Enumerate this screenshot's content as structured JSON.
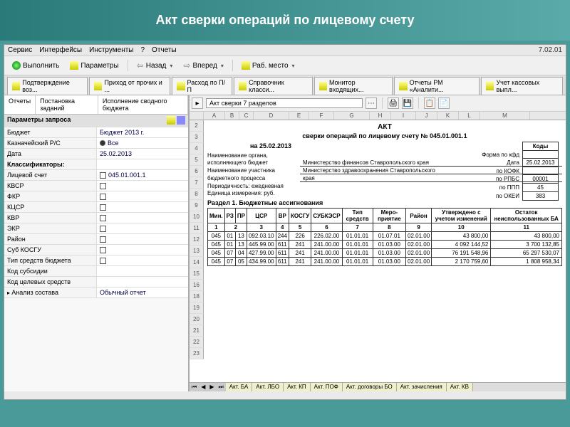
{
  "header": {
    "title": "Акт сверки операций по лицевому счету"
  },
  "menubar": {
    "items": [
      "Сервис",
      "Интерфейсы",
      "Инструменты",
      "?",
      "Отчеты"
    ],
    "version": "7.02.01"
  },
  "toolbar1": {
    "execute": "Выполнить",
    "params": "Параметры",
    "back": "Назад",
    "forward": "Вперед",
    "workplace": "Раб. место"
  },
  "toolbar2": {
    "tabs": [
      "Подтверждение воз...",
      "Приход от прочих и ...",
      "Расход по П/П",
      "Справочник класси...",
      "Монитор входящих...",
      "Отчеты РМ «Аналити...",
      "Учет кассовых выпл..."
    ]
  },
  "left": {
    "tabs": [
      "Отчеты",
      "Постановка заданий",
      "Исполнение сводного бюджета"
    ],
    "header": "Параметры запроса",
    "rows": [
      {
        "label": "Бюджет",
        "value": "Бюджет 2013 г."
      },
      {
        "label": "Казначейский Р/С",
        "value": "Все",
        "radio": true
      },
      {
        "label": "Дата",
        "value": "25.02.2013"
      },
      {
        "label": "Классификаторы:",
        "section": true
      },
      {
        "label": "Лицевой счет",
        "value": "045.01.001.1",
        "check": true
      },
      {
        "label": "КВСР",
        "check": true
      },
      {
        "label": "ФКР",
        "check": true
      },
      {
        "label": "КЦСР",
        "check": true
      },
      {
        "label": "КВР",
        "check": true
      },
      {
        "label": "ЭКР",
        "check": true
      },
      {
        "label": "Район",
        "check": true
      },
      {
        "label": "Суб КОСГУ",
        "check": true
      },
      {
        "label": "Тип средств бюджета",
        "check": true
      },
      {
        "label": "Код субсидии"
      },
      {
        "label": "Код целевых средств"
      },
      {
        "label": "Анализ состава",
        "value": "Обычный отчет",
        "expand": true
      }
    ]
  },
  "right": {
    "combo": "Акт сверки 7 разделов",
    "cols": [
      "A",
      "B",
      "C",
      "D",
      "E",
      "F",
      "G",
      "H",
      "I",
      "J",
      "K",
      "L",
      "M"
    ],
    "rownums": [
      2,
      3,
      4,
      5,
      6,
      7,
      8,
      9,
      10,
      11,
      12,
      13,
      14,
      15,
      16,
      18,
      19,
      20,
      21,
      22,
      23
    ],
    "doc": {
      "title": "АКТ",
      "subtitle": "сверки операций по лицевому счету № 045.01.001.1",
      "date": "на 25.02.2013",
      "codes_header": "Коды",
      "codes": [
        {
          "lbl": "Форма по кфд",
          "val": ""
        },
        {
          "lbl": "Дата",
          "val": "25.02.2013"
        },
        {
          "lbl": "по КОФК",
          "val": ""
        },
        {
          "lbl": "по РПБС",
          "val": "00001"
        },
        {
          "lbl": "по ППП",
          "val": "45"
        },
        {
          "lbl": "по ОКЕИ",
          "val": "383"
        }
      ],
      "info": [
        {
          "l": "Наименование органа,",
          "v": ""
        },
        {
          "l": "исполняющего бюджет",
          "v": "Министерство финансов Ставропольского края"
        },
        {
          "l": "Наименование участника",
          "v": "Министерство здравоохранения Ставропольского"
        },
        {
          "l": "бюджетного процесса",
          "v": "края"
        },
        {
          "l": "Периодичность: ежедневная",
          "v": ""
        },
        {
          "l": "Единица измерения: руб.",
          "v": ""
        }
      ],
      "section1": "Раздел 1. Бюджетные ассигнования"
    },
    "table": {
      "headers": [
        "Мин.",
        "РЗ",
        "ПР",
        "ЦСР",
        "ВР",
        "КОСГУ",
        "СУБКЭСР",
        "Тип средств",
        "Меро-приятие",
        "Район",
        "Утверждено с учетом изменений",
        "Остаток неиспользованных БА"
      ],
      "numrow": [
        "1",
        "2",
        "3",
        "4",
        "5",
        "6",
        "7",
        "8",
        "9",
        "10",
        "11"
      ],
      "rows": [
        [
          "045",
          "01",
          "13",
          "092.03.10",
          "244",
          "226",
          "226.02.00",
          "01.01.01",
          "01.07.01",
          "02.01.00",
          "43 800,00",
          "43 800,00"
        ],
        [
          "045",
          "01",
          "13",
          "445.99.00",
          "611",
          "241",
          "241.00.00",
          "01.01.01",
          "01.03.00",
          "02.01.00",
          "4 092 144,52",
          "3 700 132,85"
        ],
        [
          "045",
          "07",
          "04",
          "427.99.00",
          "611",
          "241",
          "241.00.00",
          "01.01.01",
          "01.03.00",
          "02.01.00",
          "76 191 548,96",
          "65 297 530,07"
        ],
        [
          "045",
          "07",
          "05",
          "434.99.00",
          "611",
          "241",
          "241.00.00",
          "01.01.01",
          "01.03.00",
          "02.01.00",
          "2 170 759,60",
          "1 808 958,34"
        ]
      ]
    },
    "sheet_tabs": [
      "Акт. БА",
      "Акт. ЛБО",
      "Акт. КП",
      "Акт. ПОФ",
      "Акт. договоры БО",
      "Акт. зачисления",
      "Акт. КВ"
    ]
  }
}
